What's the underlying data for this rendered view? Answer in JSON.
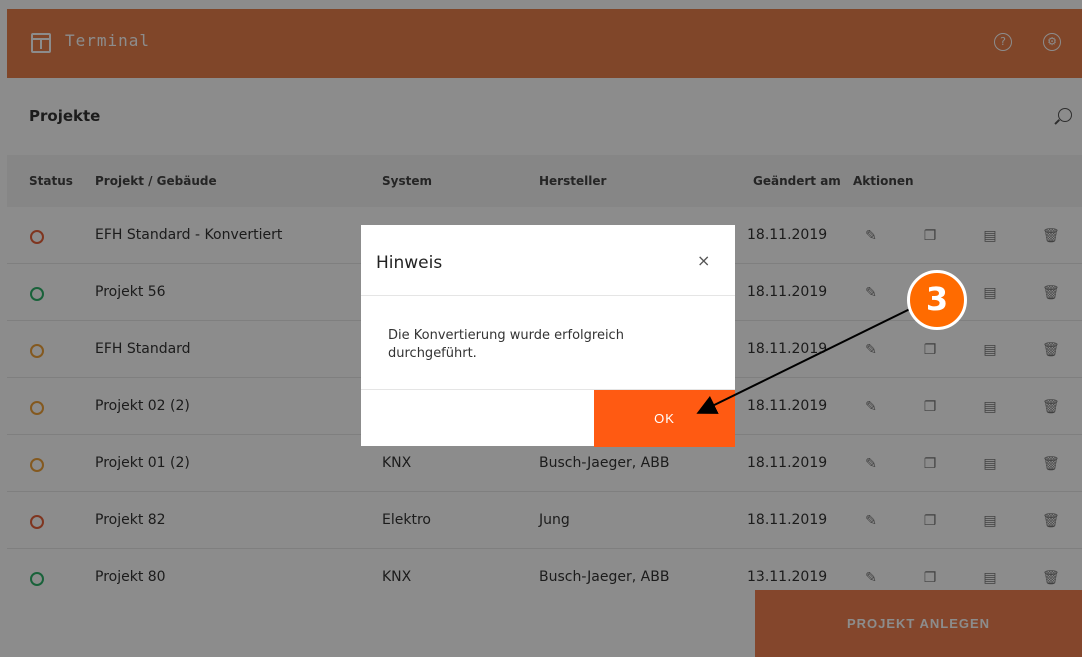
{
  "app": {
    "title": "Terminal",
    "icons": {
      "help": "help-icon",
      "settings": "gear-icon",
      "search": "search-icon"
    }
  },
  "page": {
    "title": "Projekte"
  },
  "table": {
    "headers": [
      "Status",
      "Projekt / Gebäude",
      "System",
      "Hersteller",
      "Geändert am",
      "Aktionen"
    ],
    "rows": [
      {
        "status": "orange-red",
        "name": "EFH Standard - Konvertiert",
        "system": "",
        "hersteller": "",
        "date": "18.11.2019"
      },
      {
        "status": "green",
        "name": "Projekt 56",
        "system": "",
        "hersteller": "",
        "date": "18.11.2019"
      },
      {
        "status": "orange",
        "name": "EFH Standard",
        "system": "",
        "hersteller": "",
        "date": "18.11.2019"
      },
      {
        "status": "orange",
        "name": "Projekt 02 (2)",
        "system": "",
        "hersteller": "",
        "date": "18.11.2019"
      },
      {
        "status": "orange",
        "name": "Projekt 01 (2)",
        "system": "KNX",
        "hersteller": "Busch-Jaeger, ABB",
        "date": "18.11.2019"
      },
      {
        "status": "orange-red",
        "name": "Projekt 82",
        "system": "Elektro",
        "hersteller": "Jung",
        "date": "18.11.2019"
      },
      {
        "status": "green",
        "name": "Projekt 80",
        "system": "KNX",
        "hersteller": "Busch-Jaeger, ABB",
        "date": "13.11.2019"
      }
    ],
    "action_icons": [
      "pencil-icon",
      "copy-icon",
      "document-icon",
      "trash-icon"
    ]
  },
  "footer": {
    "create_label": "PROJEKT ANLEGEN"
  },
  "modal": {
    "title": "Hinweis",
    "close_glyph": "×",
    "message": "Die Konvertierung wurde erfolgreich durchgeführt.",
    "ok_label": "OK"
  },
  "annotation": {
    "step": "3"
  },
  "colors": {
    "brand": "#e9804c",
    "ok_button": "#ff5a12",
    "step_badge": "#ff6b00",
    "status_green": "#2fb36b",
    "status_orange": "#f0a23a",
    "status_orange_red": "#e8623a"
  }
}
